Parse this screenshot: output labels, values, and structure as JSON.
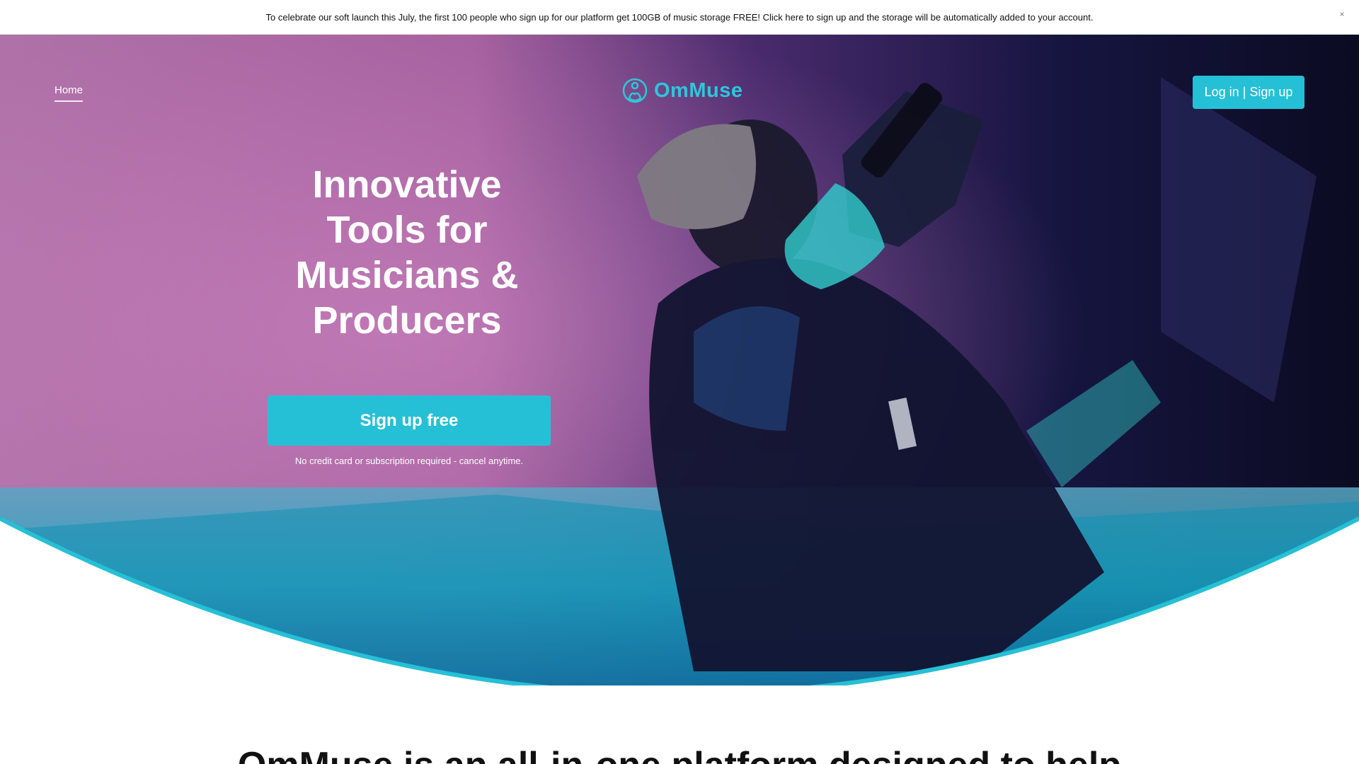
{
  "announcement": {
    "text": "To celebrate our soft launch this July, the first 100 people who sign up for our platform get 100GB of music storage FREE! Click here to sign up and the storage will be automatically added to your account.",
    "close_symbol": "×"
  },
  "nav": {
    "home_label": "Home"
  },
  "brand": {
    "name": "OmMuse",
    "logo_icon": "ommuse-logo-icon",
    "color": "#2ec6dc"
  },
  "header": {
    "login_label": "Log in | Sign up"
  },
  "hero": {
    "headline": "Innovative Tools for Musicians & Producers",
    "cta_label": "Sign up free",
    "cta_note": "No credit card or subscription required - cancel anytime.",
    "accent_color": "#26c0d6"
  },
  "section": {
    "heading_partial": "OmMuse is an all-in-one platform designed to help"
  }
}
